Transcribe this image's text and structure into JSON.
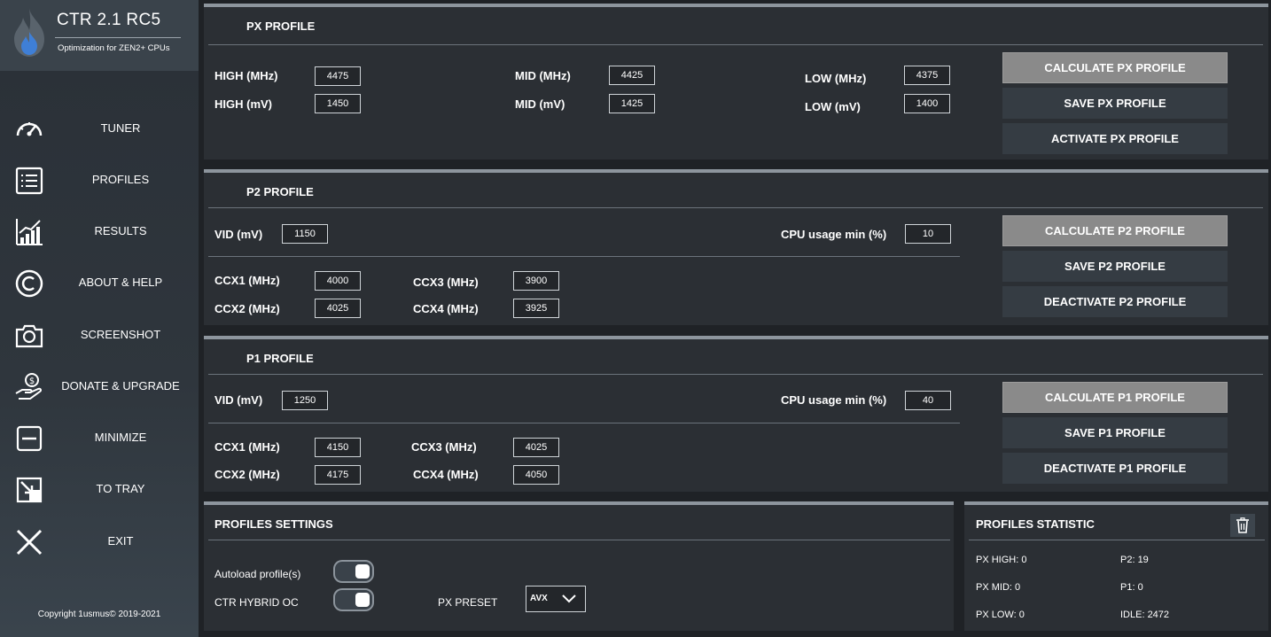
{
  "app": {
    "title": "CTR 2.1 RC5",
    "subtitle": "Optimization for ZEN2+ CPUs",
    "copyright": "Copyright 1usmus© 2019-2021"
  },
  "nav": [
    {
      "label": "TUNER",
      "icon": "speedometer-icon"
    },
    {
      "label": "PROFILES",
      "icon": "list-icon"
    },
    {
      "label": "RESULTS",
      "icon": "bar-chart-icon"
    },
    {
      "label": "ABOUT & HELP",
      "icon": "copyright-icon"
    },
    {
      "label": "SCREENSHOT",
      "icon": "camera-icon"
    },
    {
      "label": "DONATE & UPGRADE",
      "icon": "donate-hand-icon"
    },
    {
      "label": "MINIMIZE",
      "icon": "minimize-icon"
    },
    {
      "label": "TO TRAY",
      "icon": "to-tray-icon"
    },
    {
      "label": "EXIT",
      "icon": "close-icon"
    }
  ],
  "px": {
    "title": "PX PROFILE",
    "high_mhz_label": "HIGH (MHz)",
    "high_mhz": "4475",
    "high_mv_label": "HIGH  (mV)",
    "high_mv": "1450",
    "mid_mhz_label": "MID (MHz)",
    "mid_mhz": "4425",
    "mid_mv_label": "MID (mV)",
    "mid_mv": "1425",
    "low_mhz_label": "LOW (MHz)",
    "low_mhz": "4375",
    "low_mv_label": "LOW (mV)",
    "low_mv": "1400",
    "calc_label": "CALCULATE PX PROFILE",
    "save_label": "SAVE PX PROFILE",
    "activate_label": "ACTIVATE PX PROFILE"
  },
  "p2": {
    "title": "P2 PROFILE",
    "vid_label": "VID (mV)",
    "vid": "1150",
    "cpu_usage_label": "CPU usage min (%)",
    "cpu_usage": "10",
    "ccx1_label": "CCX1 (MHz)",
    "ccx1": "4000",
    "ccx2_label": "CCX2 (MHz)",
    "ccx2": "4025",
    "ccx3_label": "CCX3 (MHz)",
    "ccx3": "3900",
    "ccx4_label": "CCX4 (MHz)",
    "ccx4": "3925",
    "calc_label": "CALCULATE P2 PROFILE",
    "save_label": "SAVE P2 PROFILE",
    "deactivate_label": "DEACTIVATE P2 PROFILE"
  },
  "p1": {
    "title": "P1 PROFILE",
    "vid_label": "VID (mV)",
    "vid": "1250",
    "cpu_usage_label": "CPU usage min (%)",
    "cpu_usage": "40",
    "ccx1_label": "CCX1 (MHz)",
    "ccx1": "4150",
    "ccx2_label": "CCX2 (MHz)",
    "ccx2": "4175",
    "ccx3_label": "CCX3 (MHz)",
    "ccx3": "4025",
    "ccx4_label": "CCX4 (MHz)",
    "ccx4": "4050",
    "calc_label": "CALCULATE P1 PROFILE",
    "save_label": "SAVE P1 PROFILE",
    "deactivate_label": "DEACTIVATE P1 PROFILE"
  },
  "settings": {
    "title": "PROFILES SETTINGS",
    "autoload_label": "Autoload profile(s)",
    "hybrid_label": "CTR HYBRID OC",
    "preset_label": "PX PRESET",
    "preset_value": "AVX"
  },
  "stats": {
    "title": "PROFILES STATISTIC",
    "px_high": "PX HIGH: 0",
    "px_mid": "PX MID: 0",
    "px_low": "PX LOW: 0",
    "p2": "P2: 19",
    "p1": "P1: 0",
    "idle": "IDLE: 2472"
  },
  "colors": {
    "panel_bg": "#2b2f34",
    "panel_top_border": "#8d959d",
    "button_bg": "#353c43",
    "calc_button_bg": "#8a8a8a",
    "flame_blue": "#3f7fd6"
  }
}
